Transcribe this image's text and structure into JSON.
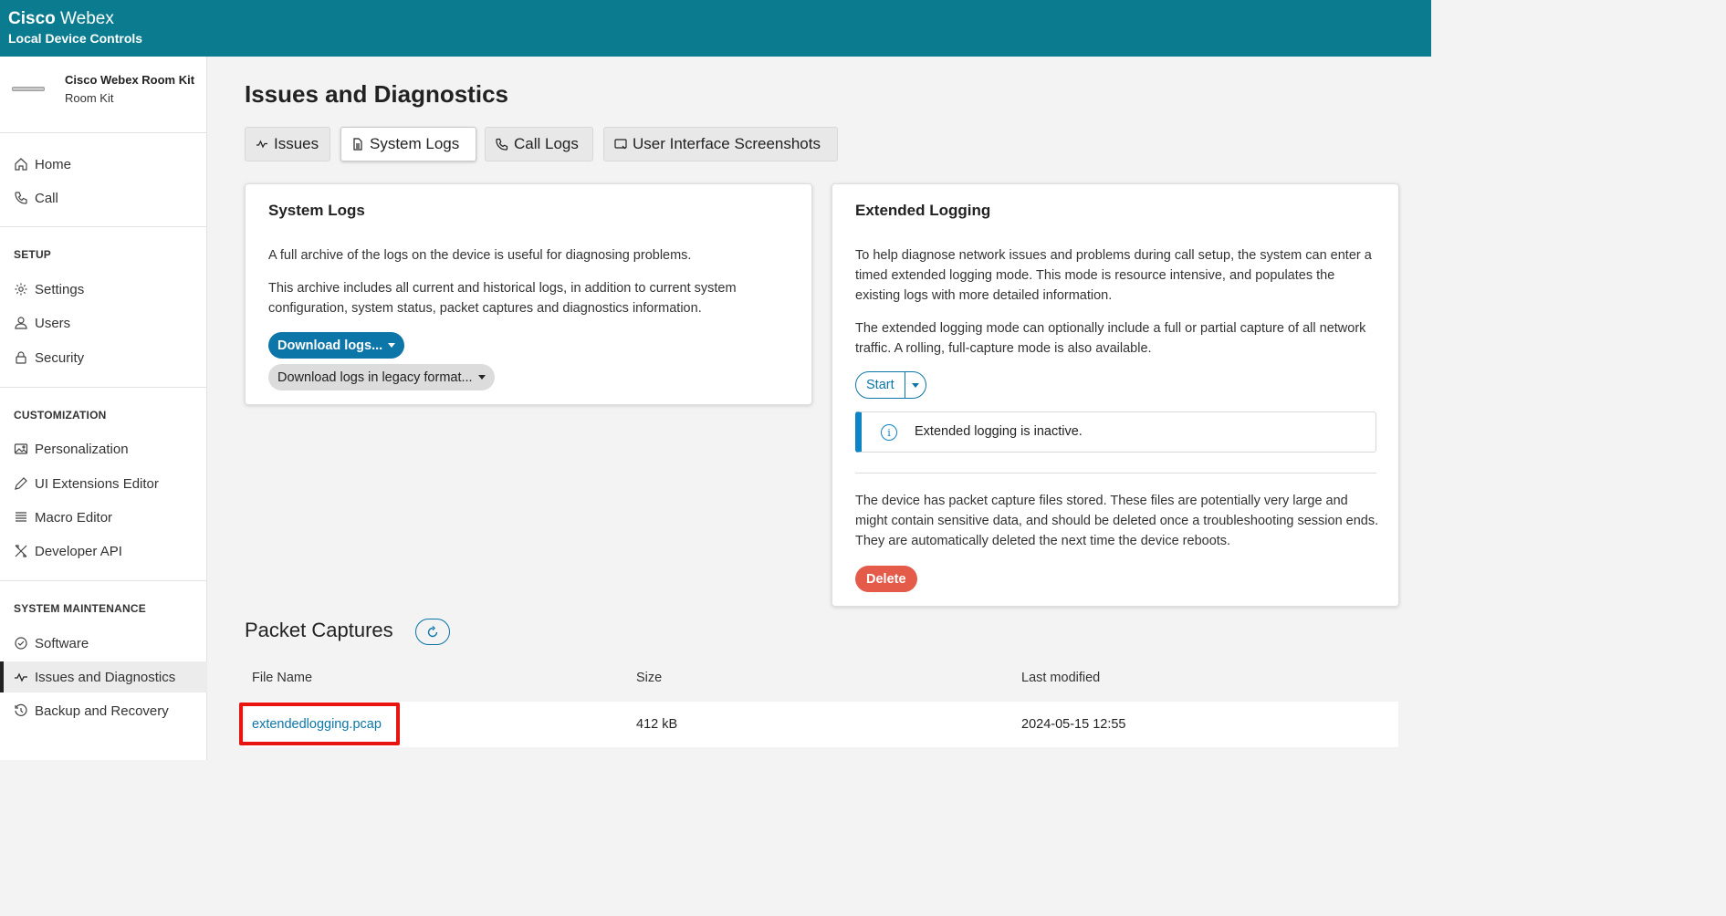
{
  "header": {
    "brand_bold": "Cisco",
    "brand_light": "Webex",
    "subtitle": "Local Device Controls"
  },
  "device": {
    "name": "Cisco Webex Room Kit",
    "model": "Room Kit"
  },
  "sidebar": {
    "home": "Home",
    "call": "Call",
    "setup_label": "SETUP",
    "settings": "Settings",
    "users": "Users",
    "security": "Security",
    "customization_label": "CUSTOMIZATION",
    "personalization": "Personalization",
    "ui_extensions": "UI Extensions Editor",
    "macro_editor": "Macro Editor",
    "developer_api": "Developer API",
    "maintenance_label": "SYSTEM MAINTENANCE",
    "software": "Software",
    "issues": "Issues and Diagnostics",
    "backup": "Backup and Recovery"
  },
  "page": {
    "title": "Issues and Diagnostics"
  },
  "tabs": [
    {
      "label": "Issues"
    },
    {
      "label": "System Logs"
    },
    {
      "label": "Call Logs"
    },
    {
      "label": "User Interface Screenshots"
    }
  ],
  "system_logs": {
    "title": "System Logs",
    "p1": "A full archive of the logs on the device is useful for diagnosing problems.",
    "p2": "This archive includes all current and historical logs, in addition to current system configuration, system status, packet captures and diagnostics information.",
    "download": "Download logs...",
    "download_legacy": "Download logs in legacy format..."
  },
  "extended_logging": {
    "title": "Extended Logging",
    "p1": "To help diagnose network issues and problems during call setup, the system can enter a timed extended logging mode. This mode is resource intensive, and populates the existing logs with more detailed information.",
    "p2": "The extended logging mode can optionally include a full or partial capture of all network traffic. A rolling, full-capture mode is also available.",
    "start": "Start",
    "status": "Extended logging is inactive.",
    "p3": "The device has packet capture files stored. These files are potentially very large and might contain sensitive data, and should be deleted once a troubleshooting session ends. They are automatically deleted the next time the device reboots.",
    "delete": "Delete"
  },
  "packet_captures": {
    "title": "Packet Captures",
    "columns": [
      "File Name",
      "Size",
      "Last modified"
    ],
    "rows": [
      {
        "file": "extendedlogging.pcap",
        "size": "412 kB",
        "modified": "2024-05-15 12:55"
      }
    ]
  },
  "colors": {
    "header": "#0b7c8f",
    "primary": "#0d76a8",
    "danger": "#e55b4a",
    "highlight": "#e8140f"
  }
}
